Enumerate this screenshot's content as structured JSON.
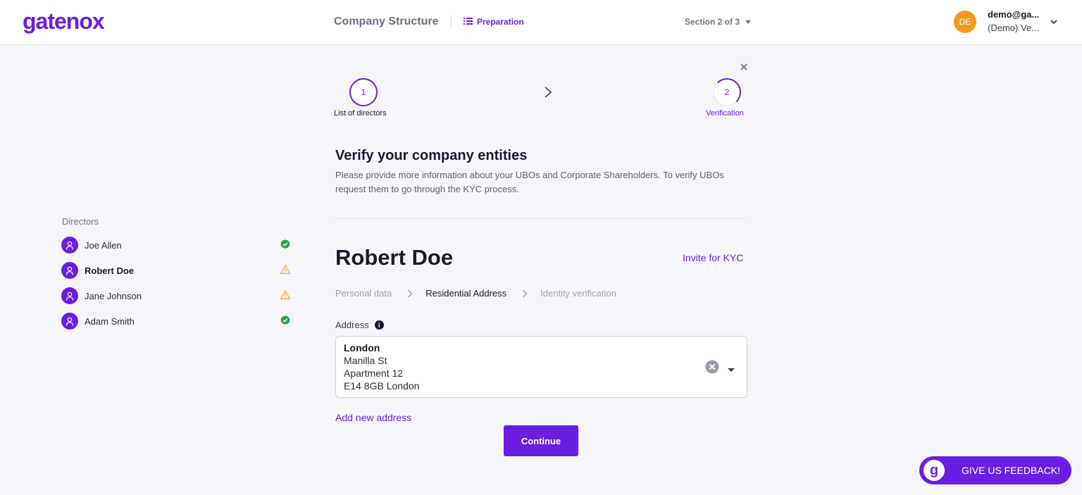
{
  "header": {
    "logo": "gatenox",
    "title": "Company Structure",
    "preparation_link": "Preparation",
    "section_selector": "Section 2 of 3",
    "user": {
      "initials": "DE",
      "email": "demo@ga...",
      "org": "(Demo) Ve..."
    }
  },
  "stepper": {
    "steps": [
      {
        "number": "1",
        "label": "List of directors"
      },
      {
        "number": "2",
        "label": "Verification"
      }
    ]
  },
  "sidebar": {
    "title": "Directors",
    "directors": [
      {
        "name": "Joe Allen",
        "status": "verified"
      },
      {
        "name": "Robert Doe",
        "status": "warning",
        "active": true
      },
      {
        "name": "Jane Johnson",
        "status": "warning"
      },
      {
        "name": "Adam Smith",
        "status": "verified"
      }
    ]
  },
  "main": {
    "heading": "Verify your company entities",
    "description": "Please provide more information about your UBOs and Corporate Shareholders. To verify UBOs request them to go through the KYC process.",
    "person_name": "Robert Doe",
    "invite_link": "Invite for KYC",
    "breadcrumb": [
      "Personal data",
      "Residential Address",
      "Identity verification"
    ],
    "address_label": "Address",
    "info_icon": "i",
    "address": {
      "city": "London",
      "lines": [
        "Manilla St",
        "Apartment 12",
        "E14 8GB London"
      ]
    },
    "add_address_link": "Add new address",
    "continue_label": "Continue"
  },
  "feedback": {
    "logo": "g",
    "label": "GIVE US FEEDBACK!"
  },
  "colors": {
    "brand": "#6a1fe0",
    "verified": "#22a652",
    "warning": "#f2b01e",
    "avatar": "#f29b1c"
  }
}
